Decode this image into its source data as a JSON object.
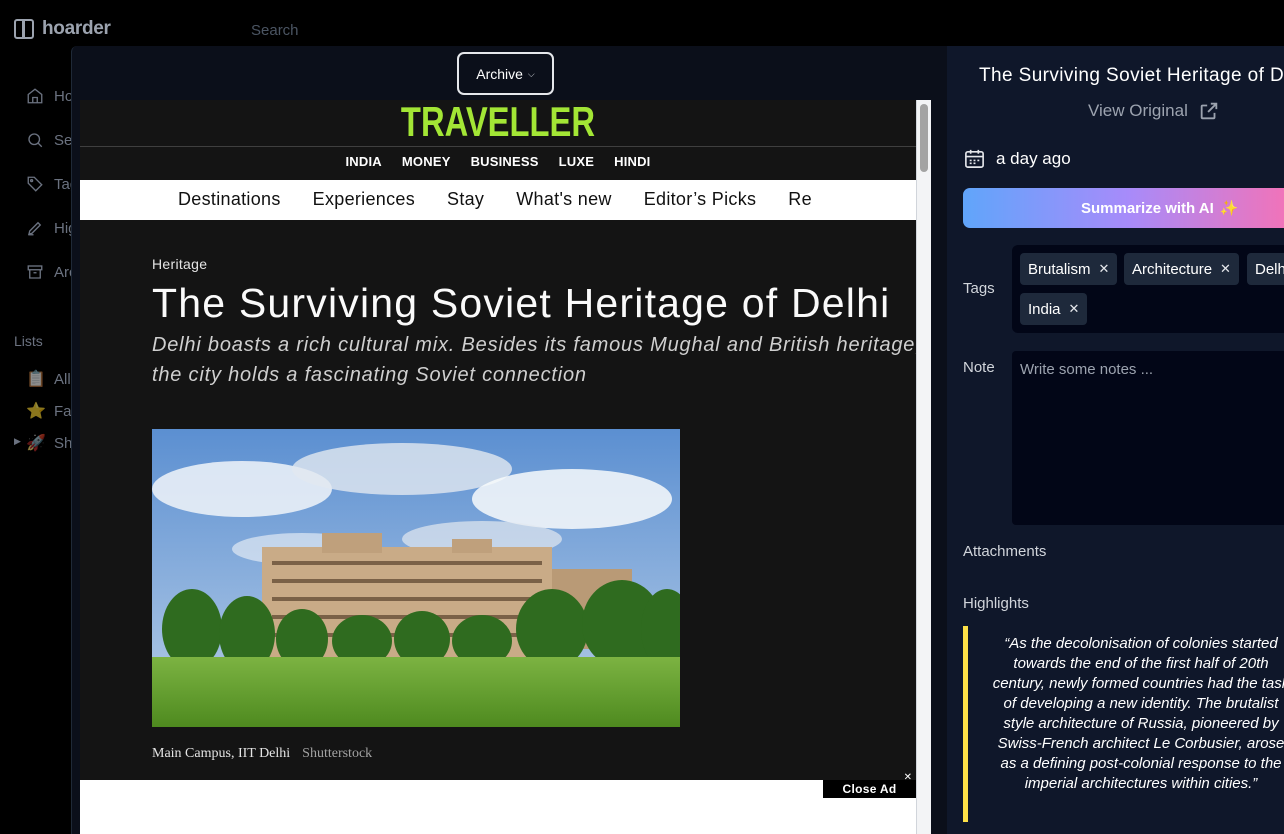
{
  "app": {
    "name": "hoarder"
  },
  "search": {
    "placeholder": "Search"
  },
  "sidebar": {
    "items": [
      {
        "label": "Home",
        "icon": "home-icon"
      },
      {
        "label": "Search",
        "icon": "search-icon"
      },
      {
        "label": "Tags",
        "icon": "tag-icon"
      },
      {
        "label": "Highlights",
        "icon": "highlighter-icon"
      },
      {
        "label": "Archive",
        "icon": "archive-icon"
      }
    ],
    "lists_label": "Lists",
    "lists": [
      {
        "label": "All Lists",
        "icon": "clipboard-icon"
      },
      {
        "label": "Favourites",
        "icon": "star-icon"
      },
      {
        "label": "Shared",
        "icon": "rocket-icon"
      }
    ]
  },
  "toolbar": {
    "archive_label": "Archive"
  },
  "article": {
    "brand": "TRAVELLER",
    "sections": [
      "INDIA",
      "MONEY",
      "BUSINESS",
      "LUXE",
      "HINDI"
    ],
    "nav": [
      "Destinations",
      "Experiences",
      "Stay",
      "What's new",
      "Editor’s Picks",
      "Re"
    ],
    "kicker": "Heritage",
    "headline": "The Surviving Soviet Heritage of Delhi",
    "dek": "Delhi boasts a rich cultural mix. Besides its famous Mughal and British heritage, the city holds a fascinating Soviet connection",
    "caption": "Main Campus, IIT Delhi",
    "credit": "Shutterstock",
    "close_ad": "Close Ad"
  },
  "panel": {
    "title": "The Surviving Soviet Heritage of Delhi",
    "view_original": "View Original",
    "date": "a day ago",
    "summarize_label": "Summarize with AI",
    "tags_label": "Tags",
    "tags": [
      "Brutalism",
      "Architecture",
      "Delhi",
      "India"
    ],
    "note_label": "Note",
    "note_placeholder": "Write some notes ...",
    "attachments_label": "Attachments",
    "highlights_label": "Highlights",
    "highlight_text": "“As the decolonisation of colonies started towards the end of the first half of 20th century, newly formed countries had the task of developing a new identity. The brutalist style architecture of Russia, pioneered by Swiss-French architect Le Corbusier, arose as a defining post-colonial response to the imperial architectures within cities.”"
  },
  "colors": {
    "brand_green": "#a3e635",
    "highlight_yellow": "#fde047",
    "panel_bg": "#0f172a"
  }
}
